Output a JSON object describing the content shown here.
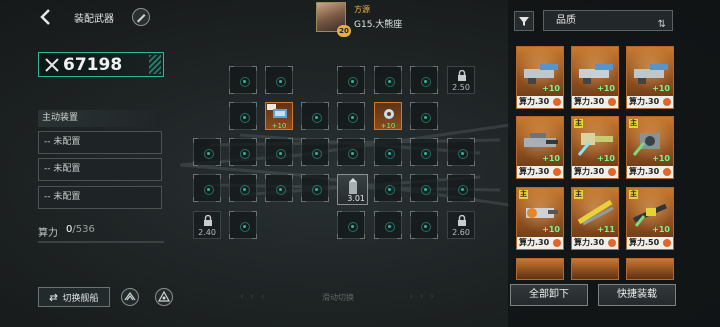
{
  "header": {
    "title": "装配武器",
    "commander_name": "方源",
    "commander_level": "20",
    "ship_name": "G15.大熊座"
  },
  "power": {
    "value": "67198"
  },
  "active_equipment": {
    "header": "主动装置",
    "slots": [
      "-- 未配置",
      "-- 未配置",
      "-- 未配置"
    ]
  },
  "compute": {
    "label": "算力",
    "current": "0",
    "max": "/536"
  },
  "grid": {
    "locks": {
      "top_right": "2.50",
      "bottom_left": "2.40",
      "bottom_right": "2.60"
    },
    "equipped": [
      {
        "plus": "+10"
      },
      {
        "plus": "+10"
      }
    ],
    "occupied_value": "3.01"
  },
  "bottom": {
    "switch_ship": "切换舰船",
    "swipe_hint": "滑动切换"
  },
  "panel": {
    "sort_label": "品质",
    "items": [
      {
        "plus": "+10",
        "power": "算力.30",
        "badge": ""
      },
      {
        "plus": "+10",
        "power": "算力.30",
        "badge": ""
      },
      {
        "plus": "+10",
        "power": "算力.30",
        "badge": ""
      },
      {
        "plus": "+10",
        "power": "算力.30",
        "badge": ""
      },
      {
        "plus": "+10",
        "power": "算力.30",
        "badge": "主"
      },
      {
        "plus": "+10",
        "power": "算力.30",
        "badge": "主"
      },
      {
        "plus": "+10",
        "power": "算力.30",
        "badge": "主"
      },
      {
        "plus": "+11",
        "power": "算力.30",
        "badge": "主"
      },
      {
        "plus": "+10",
        "power": "算力.50",
        "badge": "主"
      }
    ],
    "unequip_all": "全部卸下",
    "quick_equip": "快捷装载"
  },
  "colors": {
    "accent": "#2fb59a",
    "rarity_orange": "#c77a2f",
    "plus_green": "#7ef28a"
  },
  "icons": [
    "back-icon",
    "pen-icon",
    "sword-icon",
    "lock-icon",
    "filter-icon",
    "sort-icon",
    "swap-icon",
    "fleet-icon",
    "radar-icon"
  ]
}
